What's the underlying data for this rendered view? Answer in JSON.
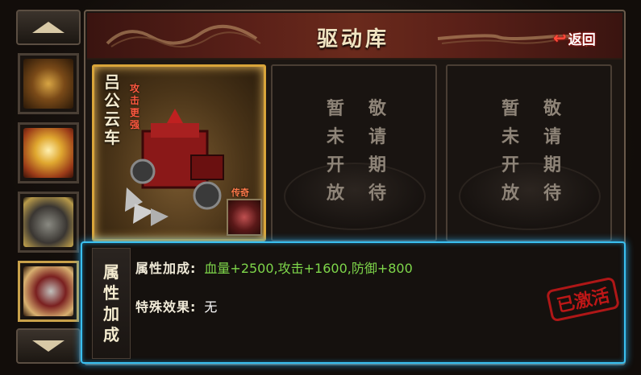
{
  "header": {
    "title": "驱动库",
    "back_label": "返回"
  },
  "sidebar": {
    "thumbnails": [
      {
        "name": "thumb-1"
      },
      {
        "name": "thumb-2"
      },
      {
        "name": "thumb-3"
      },
      {
        "name": "thumb-4"
      }
    ],
    "up_icon": "arrow-up-icon",
    "down_icon": "arrow-down-icon"
  },
  "cards": {
    "active": {
      "name": "吕公云车",
      "desc": "攻击更强",
      "rarity": "传奇"
    },
    "coming_soon_text": [
      "暂",
      "敬",
      "未",
      "请",
      "开",
      "期",
      "放",
      "待"
    ]
  },
  "attributes": {
    "side_title": [
      "属",
      "性",
      "加",
      "成"
    ],
    "bonus_label": "属性加成:",
    "bonus_value": "血量+2500,攻击+1600,防御+800",
    "effect_label": "特殊效果:",
    "effect_value": "无",
    "stamp": "已激活"
  },
  "colors": {
    "accent_gold": "#d9a53a",
    "highlight_blue": "#3ac0f0",
    "bonus_green": "#7ed64a",
    "stamp_red": "#c01818"
  }
}
